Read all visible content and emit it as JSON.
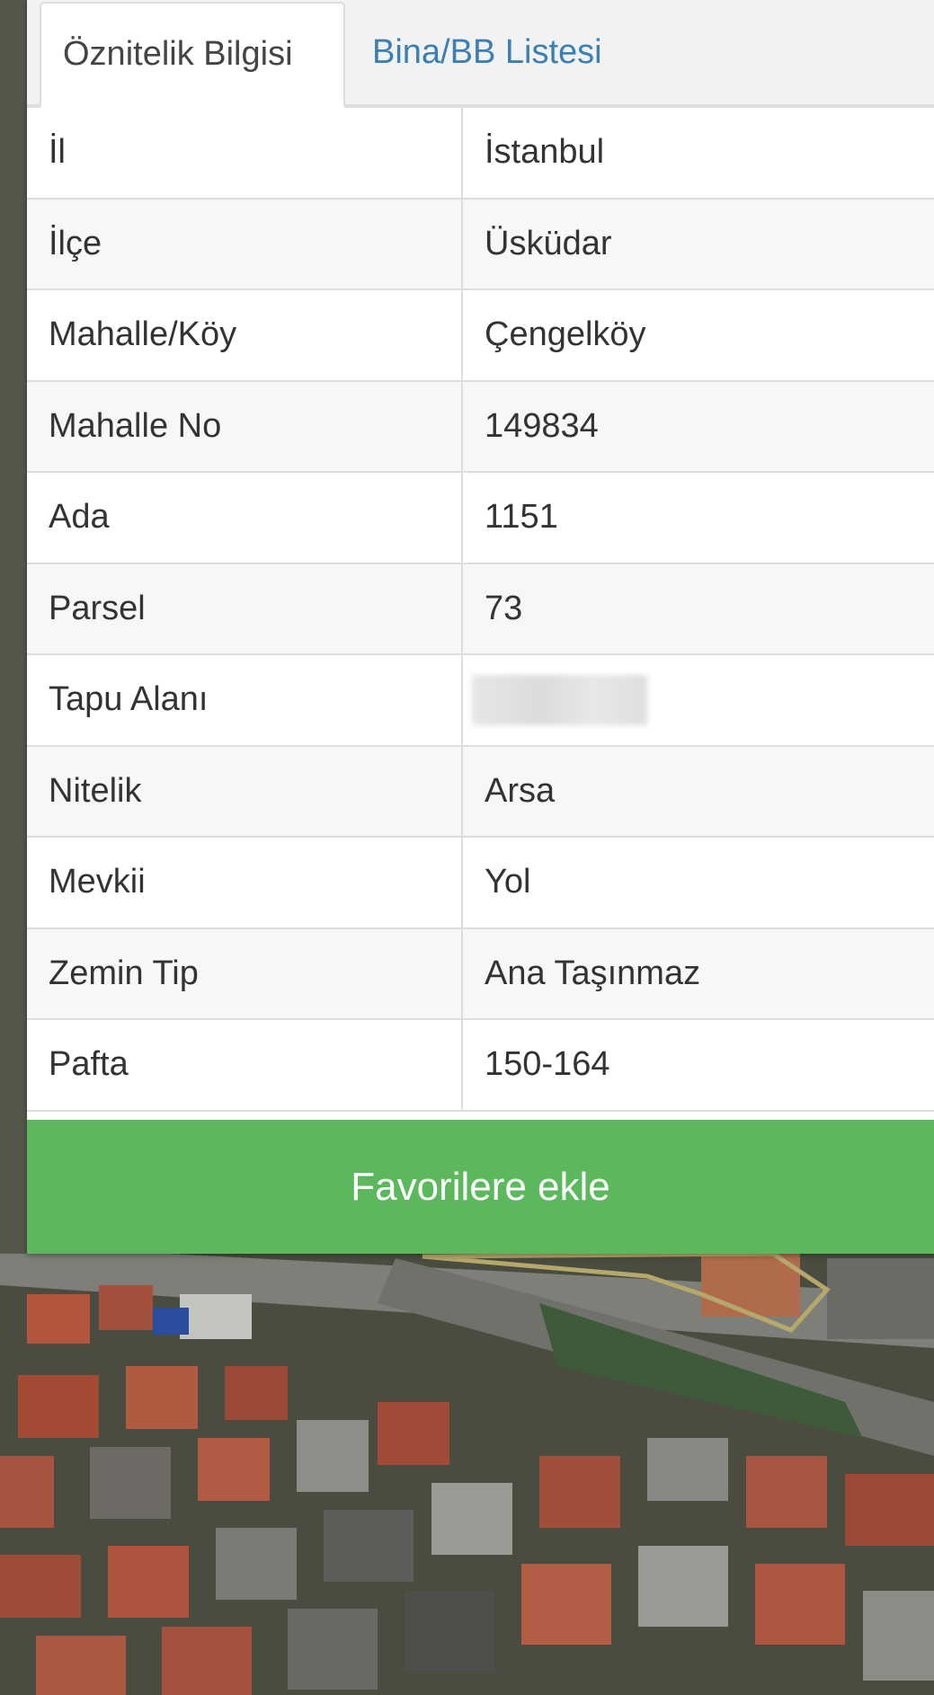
{
  "tabs": [
    {
      "label": "Öznitelik Bilgisi",
      "active": true
    },
    {
      "label": "Bina/BB Listesi",
      "active": false
    }
  ],
  "attributes": [
    {
      "key": "İl",
      "value": "İstanbul"
    },
    {
      "key": "İlçe",
      "value": "Üsküdar"
    },
    {
      "key": "Mahalle/Köy",
      "value": "Çengelköy"
    },
    {
      "key": "Mahalle No",
      "value": "149834"
    },
    {
      "key": "Ada",
      "value": "1151"
    },
    {
      "key": "Parsel",
      "value": "73"
    },
    {
      "key": "Tapu Alanı",
      "value": ""
    },
    {
      "key": "Nitelik",
      "value": "Arsa"
    },
    {
      "key": "Mevkii",
      "value": "Yol"
    },
    {
      "key": "Zemin Tip",
      "value": "Ana Taşınmaz"
    },
    {
      "key": "Pafta",
      "value": "150-164"
    }
  ],
  "favorite_button": {
    "label": "Favorilere ekle"
  },
  "colors": {
    "tab_active_text": "#444444",
    "tab_inactive_text": "#3a7fb5",
    "button_bg": "#5cb85c",
    "button_text": "#ffffff",
    "parcel_outline": "#b5a86a"
  }
}
